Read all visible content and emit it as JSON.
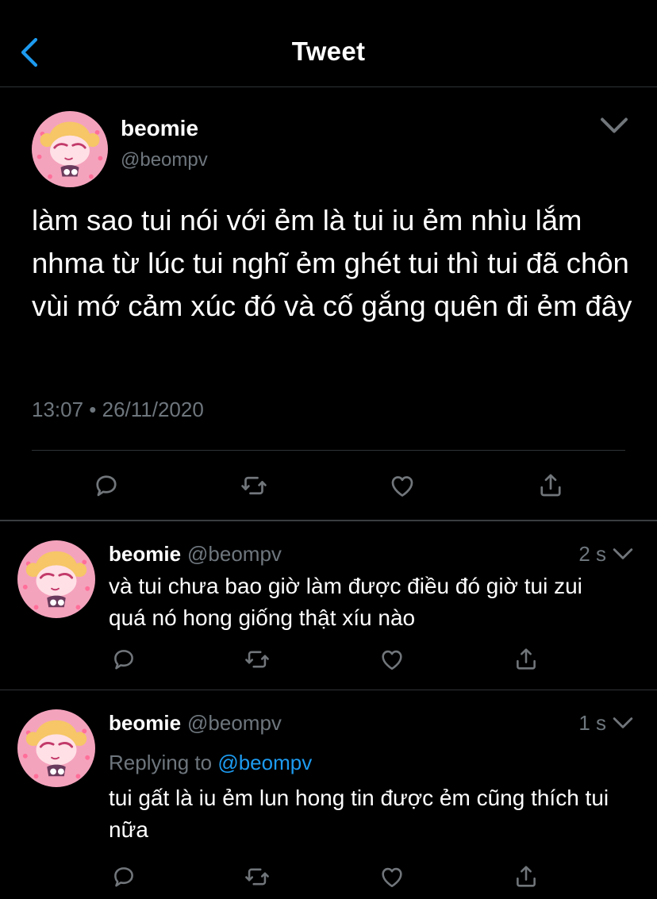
{
  "header": {
    "title": "Tweet",
    "back_icon": "chevron-left-icon",
    "accent": "#1d9bf0"
  },
  "tweet": {
    "name": "beomie",
    "handle": "@beompv",
    "text": "làm sao tui nói với ẻm là tui iu ẻm nhìu lắm nhma từ lúc tui nghĩ ẻm ghét tui thì tui đã chôn vùi mớ cảm xúc đó và cố gắng quên đi ẻm đây",
    "timestamp": "13:07 • 26/11/2020"
  },
  "replies": [
    {
      "name": "beomie",
      "handle": "@beompv",
      "time": "2 s",
      "text": "và tui chưa bao giờ làm được điều đó giờ tui zui quá nó hong giống thật xíu nào"
    },
    {
      "name": "beomie",
      "handle": "@beompv",
      "time": "1 s",
      "replying_label": "Replying to",
      "replying_to": "@beompv",
      "text": "tui gất là iu ẻm lun hong tin được ẻm cũng thích tui nữa"
    }
  ],
  "icons": [
    "reply-icon",
    "retweet-icon",
    "like-icon",
    "share-icon",
    "chevron-down-icon"
  ]
}
